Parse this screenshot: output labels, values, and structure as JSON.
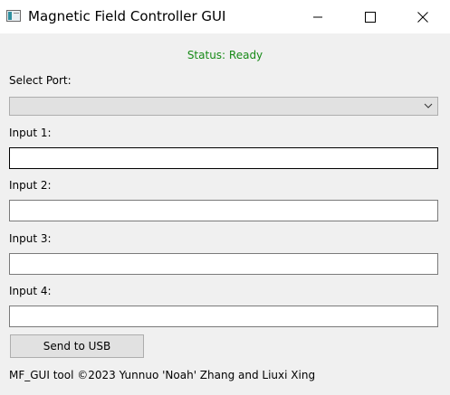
{
  "window": {
    "title": "Magnetic Field Controller GUI",
    "icon": "app-window-icon",
    "controls": [
      "minimize-icon",
      "maximize-icon",
      "close-icon"
    ]
  },
  "status": {
    "text": "Status: Ready",
    "color": "#178a17"
  },
  "port": {
    "label": "Select Port:",
    "selected": ""
  },
  "inputs": [
    {
      "label": "Input 1:",
      "value": ""
    },
    {
      "label": "Input 2:",
      "value": ""
    },
    {
      "label": "Input 3:",
      "value": ""
    },
    {
      "label": "Input 4:",
      "value": ""
    }
  ],
  "send_button": {
    "label": "Send to USB"
  },
  "footer": {
    "text": "MF_GUI tool ©2023 Yunnuo 'Noah' Zhang and Liuxi Xing"
  }
}
